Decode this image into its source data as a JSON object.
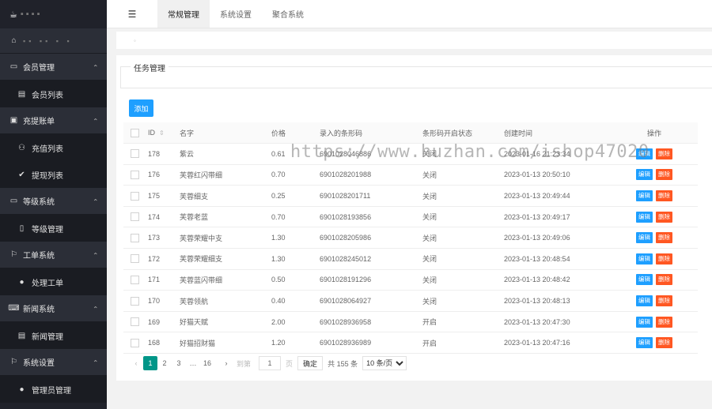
{
  "sidebar": {
    "home_glyph": "⌂",
    "groups": [
      {
        "label": "会员管理",
        "icon": "window-icon",
        "items": [
          {
            "label": "会员列表",
            "icon": "list-icon"
          }
        ]
      },
      {
        "label": "充提账单",
        "icon": "card-icon",
        "items": [
          {
            "label": "充值列表",
            "icon": "users-icon"
          },
          {
            "label": "提现列表",
            "icon": "check-circle-icon"
          }
        ]
      },
      {
        "label": "等级系统",
        "icon": "laptop-icon",
        "items": [
          {
            "label": "等级管理",
            "icon": "mobile-icon"
          }
        ]
      },
      {
        "label": "工单系统",
        "icon": "flag-icon",
        "items": [
          {
            "label": "处理工单",
            "icon": "settings-circle-icon"
          }
        ]
      },
      {
        "label": "新闻系统",
        "icon": "keyboard-icon",
        "items": [
          {
            "label": "新闻管理",
            "icon": "list-icon"
          }
        ]
      },
      {
        "label": "系统设置",
        "icon": "flag-icon",
        "items": [
          {
            "label": "管理员管理",
            "icon": "settings-circle-icon"
          }
        ]
      }
    ]
  },
  "topbar": {
    "tabs": [
      "常规管理",
      "系统设置",
      "聚合系统"
    ]
  },
  "card": {
    "legend": "任务管理",
    "add_label": "添加"
  },
  "watermark": "https://www.huzhan.com/ishop47020",
  "table": {
    "columns": [
      "ID",
      "名字",
      "价格",
      "录入的条形码",
      "条形码开启状态",
      "创建时间",
      "操作"
    ],
    "rows": [
      {
        "id": "178",
        "name": "紫云",
        "price": "0.61",
        "barcode": "6901028046886",
        "status": "关闭",
        "created": "2023-01-16 21:23:34"
      },
      {
        "id": "176",
        "name": "芙蓉红闪带细",
        "price": "0.70",
        "barcode": "6901028201988",
        "status": "关闭",
        "created": "2023-01-13 20:50:10"
      },
      {
        "id": "175",
        "name": "芙蓉细支",
        "price": "0.25",
        "barcode": "6901028201711",
        "status": "关闭",
        "created": "2023-01-13 20:49:44"
      },
      {
        "id": "174",
        "name": "芙蓉老蓝",
        "price": "0.70",
        "barcode": "6901028193856",
        "status": "关闭",
        "created": "2023-01-13 20:49:17"
      },
      {
        "id": "173",
        "name": "芙蓉荣耀中支",
        "price": "1.30",
        "barcode": "6901028205986",
        "status": "关闭",
        "created": "2023-01-13 20:49:06"
      },
      {
        "id": "172",
        "name": "芙蓉荣耀细支",
        "price": "1.30",
        "barcode": "6901028245012",
        "status": "关闭",
        "created": "2023-01-13 20:48:54"
      },
      {
        "id": "171",
        "name": "芙蓉蓝闪带细",
        "price": "0.50",
        "barcode": "6901028191296",
        "status": "关闭",
        "created": "2023-01-13 20:48:42"
      },
      {
        "id": "170",
        "name": "芙蓉领航",
        "price": "0.40",
        "barcode": "6901028064927",
        "status": "关闭",
        "created": "2023-01-13 20:48:13"
      },
      {
        "id": "169",
        "name": "好猫天赋",
        "price": "2.00",
        "barcode": "6901028936958",
        "status": "开启",
        "created": "2023-01-13 20:47:30"
      },
      {
        "id": "168",
        "name": "好猫招财猫",
        "price": "1.20",
        "barcode": "6901028936989",
        "status": "开启",
        "created": "2023-01-13 20:47:16"
      }
    ],
    "edit_label": "编辑",
    "delete_label": "删除"
  },
  "pager": {
    "pages": [
      "1",
      "2",
      "3",
      "…",
      "16"
    ],
    "goto_label": "到第",
    "page_value": "1",
    "page_unit": "页",
    "confirm_label": "确定",
    "total_label": "共 155 条",
    "size_option": "10 条/页"
  },
  "colors": {
    "sidebar_bg": "#20222a",
    "primary": "#1e9fff",
    "danger": "#ff5722",
    "pager_active": "#009688"
  }
}
